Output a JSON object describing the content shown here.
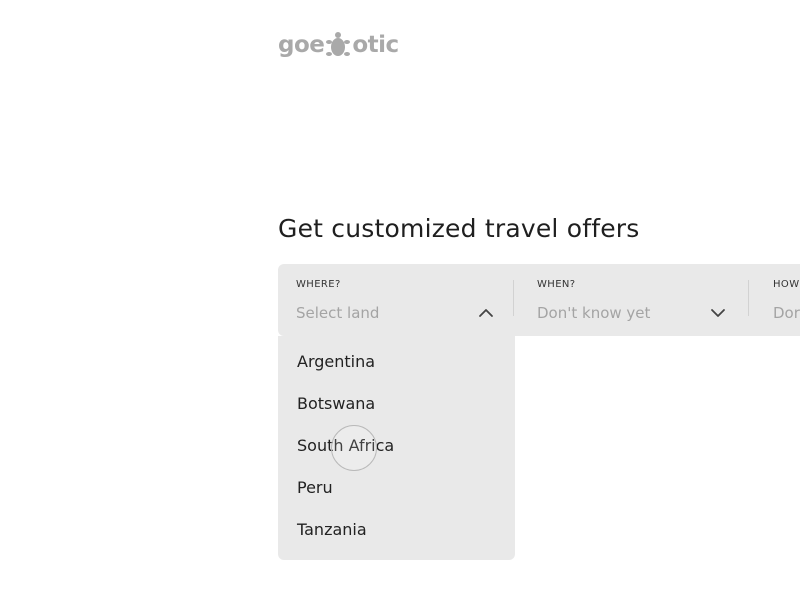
{
  "logo": {
    "left": "goe",
    "right": "otic"
  },
  "headline": "Get customized travel offers",
  "search": {
    "where": {
      "label": "WHERE?",
      "placeholder": "Select land"
    },
    "when": {
      "label": "WHEN?",
      "value": "Don't know yet"
    },
    "how": {
      "label": "HOW",
      "value": "Dor"
    }
  },
  "dropdown": {
    "options": [
      "Argentina",
      "Botswana",
      "South Africa",
      "Peru",
      "Tanzania"
    ]
  },
  "colors": {
    "panel_bg": "#e9e9e9",
    "logo_gray": "#a9a9a9",
    "placeholder_gray": "#a4a4a4"
  },
  "icons": {
    "logo_mark": "turtle-icon",
    "where_toggle": "chevron-up-icon",
    "when_toggle": "chevron-down-icon"
  }
}
